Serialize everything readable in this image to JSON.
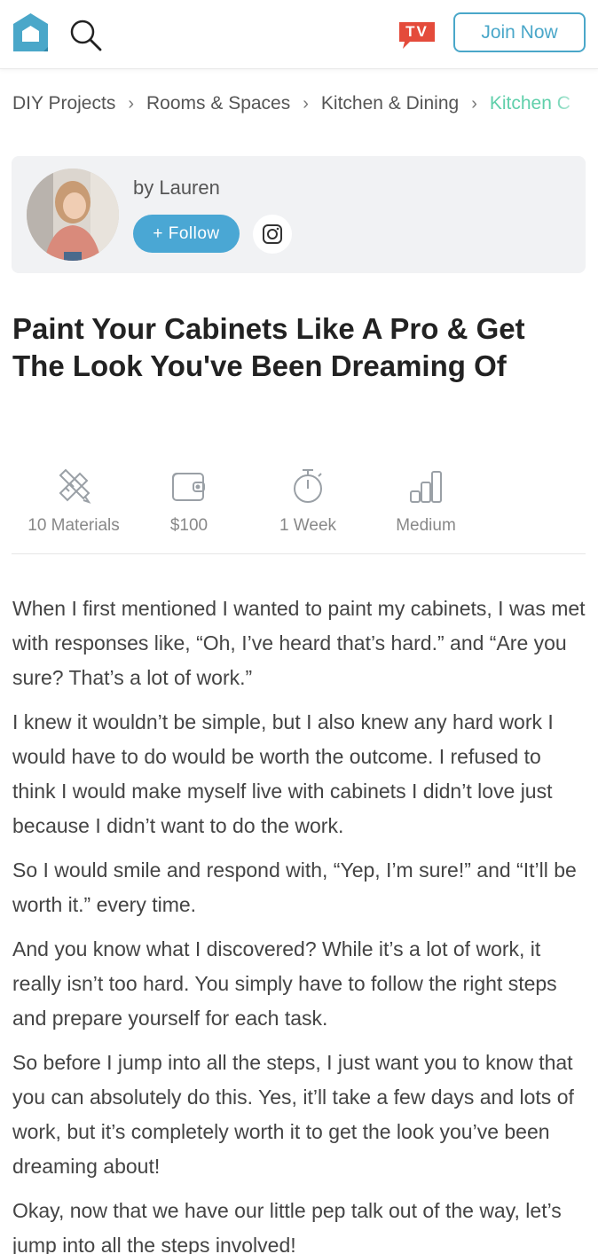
{
  "header": {
    "logo_icon": "house-logo-icon",
    "search_icon": "search-icon",
    "tv_badge": "TV",
    "join_label": "Join Now",
    "accent": "#4aa7c9",
    "tv_color": "#e44b3b"
  },
  "breadcrumb": {
    "items": [
      "DIY Projects",
      "Rooms & Spaces",
      "Kitchen & Dining",
      "Kitchen C"
    ],
    "separator": "›",
    "active_color": "#5fcfaa"
  },
  "author": {
    "byline": "by Lauren",
    "follow_label": "+ Follow",
    "instagram_icon": "instagram-icon"
  },
  "article": {
    "title": "Paint Your Cabinets Like A Pro & Get The Look You've Been Dreaming Of",
    "stats": [
      {
        "icon": "materials-icon",
        "label": "10 Materials"
      },
      {
        "icon": "wallet-icon",
        "label": "$100"
      },
      {
        "icon": "timer-icon",
        "label": "1 Week"
      },
      {
        "icon": "difficulty-icon",
        "label": "Medium"
      }
    ],
    "paragraphs": [
      "When I first mentioned I wanted to paint my cabinets, I was met with responses like, “Oh, I’ve heard that’s hard.” and “Are you sure? That’s a lot of work.”",
      "I knew it wouldn’t be simple, but I also knew any hard work I would have to do would be worth the outcome. I refused to think I would make myself live with cabinets I didn’t love just because I didn’t want to do the work.",
      "So I would smile and respond with, “Yep, I’m sure!” and “It’ll be worth it.” every time.",
      "And you know what I discovered? While it’s a lot of work, it really isn’t too hard. You simply have to follow the right steps and prepare yourself for each task.",
      "So before I jump into all the steps, I just want you to know that you can absolutely do this. Yes, it’ll take a few days and lots of work, but it’s completely worth it to get the look you’ve been dreaming about!",
      "Okay, now that we have our little pep talk out of the way, let’s jump into all the steps involved!"
    ]
  }
}
